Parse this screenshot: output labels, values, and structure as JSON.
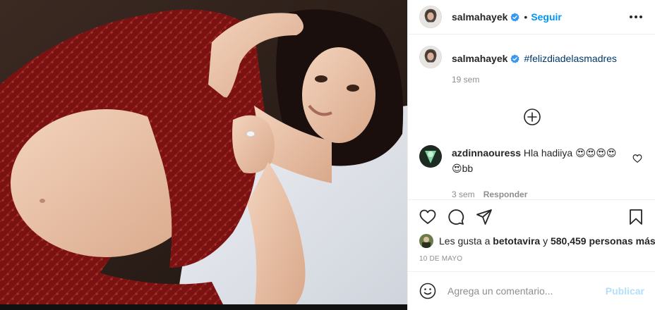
{
  "post": {
    "photo_alt": "",
    "header": {
      "username": "salmahayek",
      "dot": "•",
      "follow_label": "Seguir"
    },
    "caption": {
      "username": "salmahayek",
      "hashtag": "#felizdiadelasmadres",
      "time_ago": "19 sem"
    },
    "comments": [
      {
        "username": "azdinnaouress",
        "text": "Hla hadiiya 😍😍😍😍 😍bb",
        "time_ago": "3 sem",
        "reply_label": "Responder"
      }
    ],
    "likes": {
      "prefix": "Les gusta a",
      "liker": "betotavira",
      "conjunction": "y",
      "count_text": "580,459 personas más"
    },
    "date": "10 DE MAYO",
    "comment_box": {
      "placeholder": "Agrega un comentario...",
      "publish_label": "Publicar"
    },
    "icons": {
      "options": "more-horizontal-icon",
      "verified": "verified-badge-icon",
      "load_more": "plus-circle-icon",
      "like": "heart-icon",
      "comment": "comment-icon",
      "share": "paper-plane-icon",
      "save": "bookmark-icon",
      "emoji": "smiley-icon"
    },
    "colors": {
      "accent": "#0095f6",
      "verified": "#3897f0",
      "text": "#262626",
      "muted": "#8e8e8e",
      "publish_disabled": "#b2dffc"
    }
  }
}
